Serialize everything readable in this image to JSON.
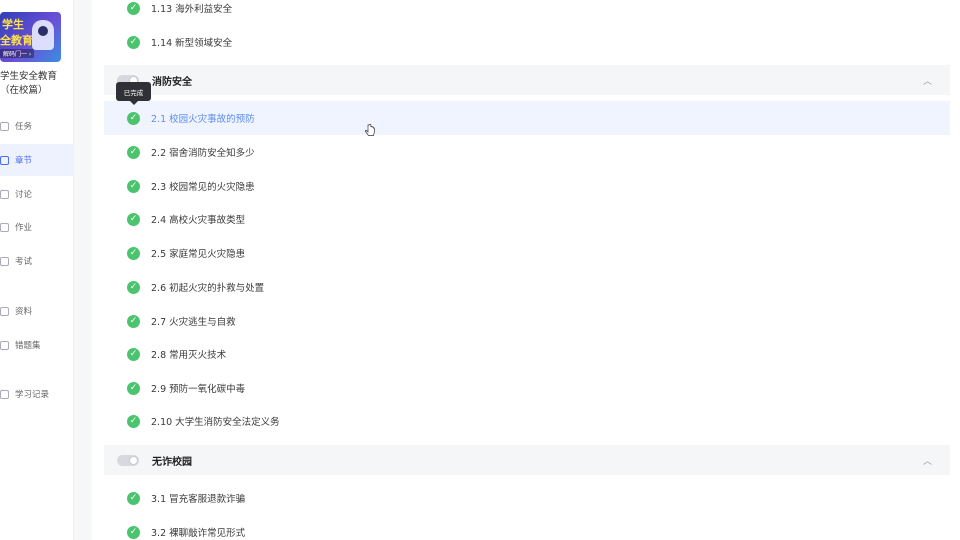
{
  "sidebar": {
    "cover": {
      "line1": "学生",
      "line2": "全教育",
      "badge": "解码门一 ›"
    },
    "course_title_line1": "学生安全教育",
    "course_title_line2": "（在校篇）",
    "items": [
      {
        "label": "任务",
        "icon": "task-icon"
      },
      {
        "label": "章节",
        "icon": "chapter-icon"
      },
      {
        "label": "讨论",
        "icon": "discussion-icon"
      },
      {
        "label": "作业",
        "icon": "homework-icon"
      },
      {
        "label": "考试",
        "icon": "exam-icon"
      },
      {
        "label": "资料",
        "icon": "materials-icon"
      },
      {
        "label": "错题集",
        "icon": "mistakes-icon"
      },
      {
        "label": "学习记录",
        "icon": "record-icon"
      }
    ]
  },
  "chapters": {
    "prev_items": [
      {
        "label": "1.13 海外利益安全"
      },
      {
        "label": "1.14 新型领域安全"
      }
    ],
    "section2": {
      "title": "消防安全"
    },
    "section2_items": [
      {
        "label": "2.1 校园火灾事故的预防"
      },
      {
        "label": "2.2 宿舍消防安全知多少"
      },
      {
        "label": "2.3 校园常见的火灾隐患"
      },
      {
        "label": "2.4 高校火灾事故类型"
      },
      {
        "label": "2.5 家庭常见火灾隐患"
      },
      {
        "label": "2.6 初起火灾的扑救与处置"
      },
      {
        "label": "2.7 火灾逃生与自救"
      },
      {
        "label": "2.8 常用灭火技术"
      },
      {
        "label": "2.9 预防一氧化碳中毒"
      },
      {
        "label": "2.10 大学生消防安全法定义务"
      }
    ],
    "section3": {
      "title": "无诈校园"
    },
    "section3_items": [
      {
        "label": "3.1 冒充客服退款诈骗"
      },
      {
        "label": "3.2 裸聊敲诈常见形式"
      }
    ]
  },
  "tooltip": "已完成",
  "colors": {
    "check": "#4cc46f",
    "active": "#5b8cf5",
    "highlight_bg": "#f0f4ff"
  }
}
